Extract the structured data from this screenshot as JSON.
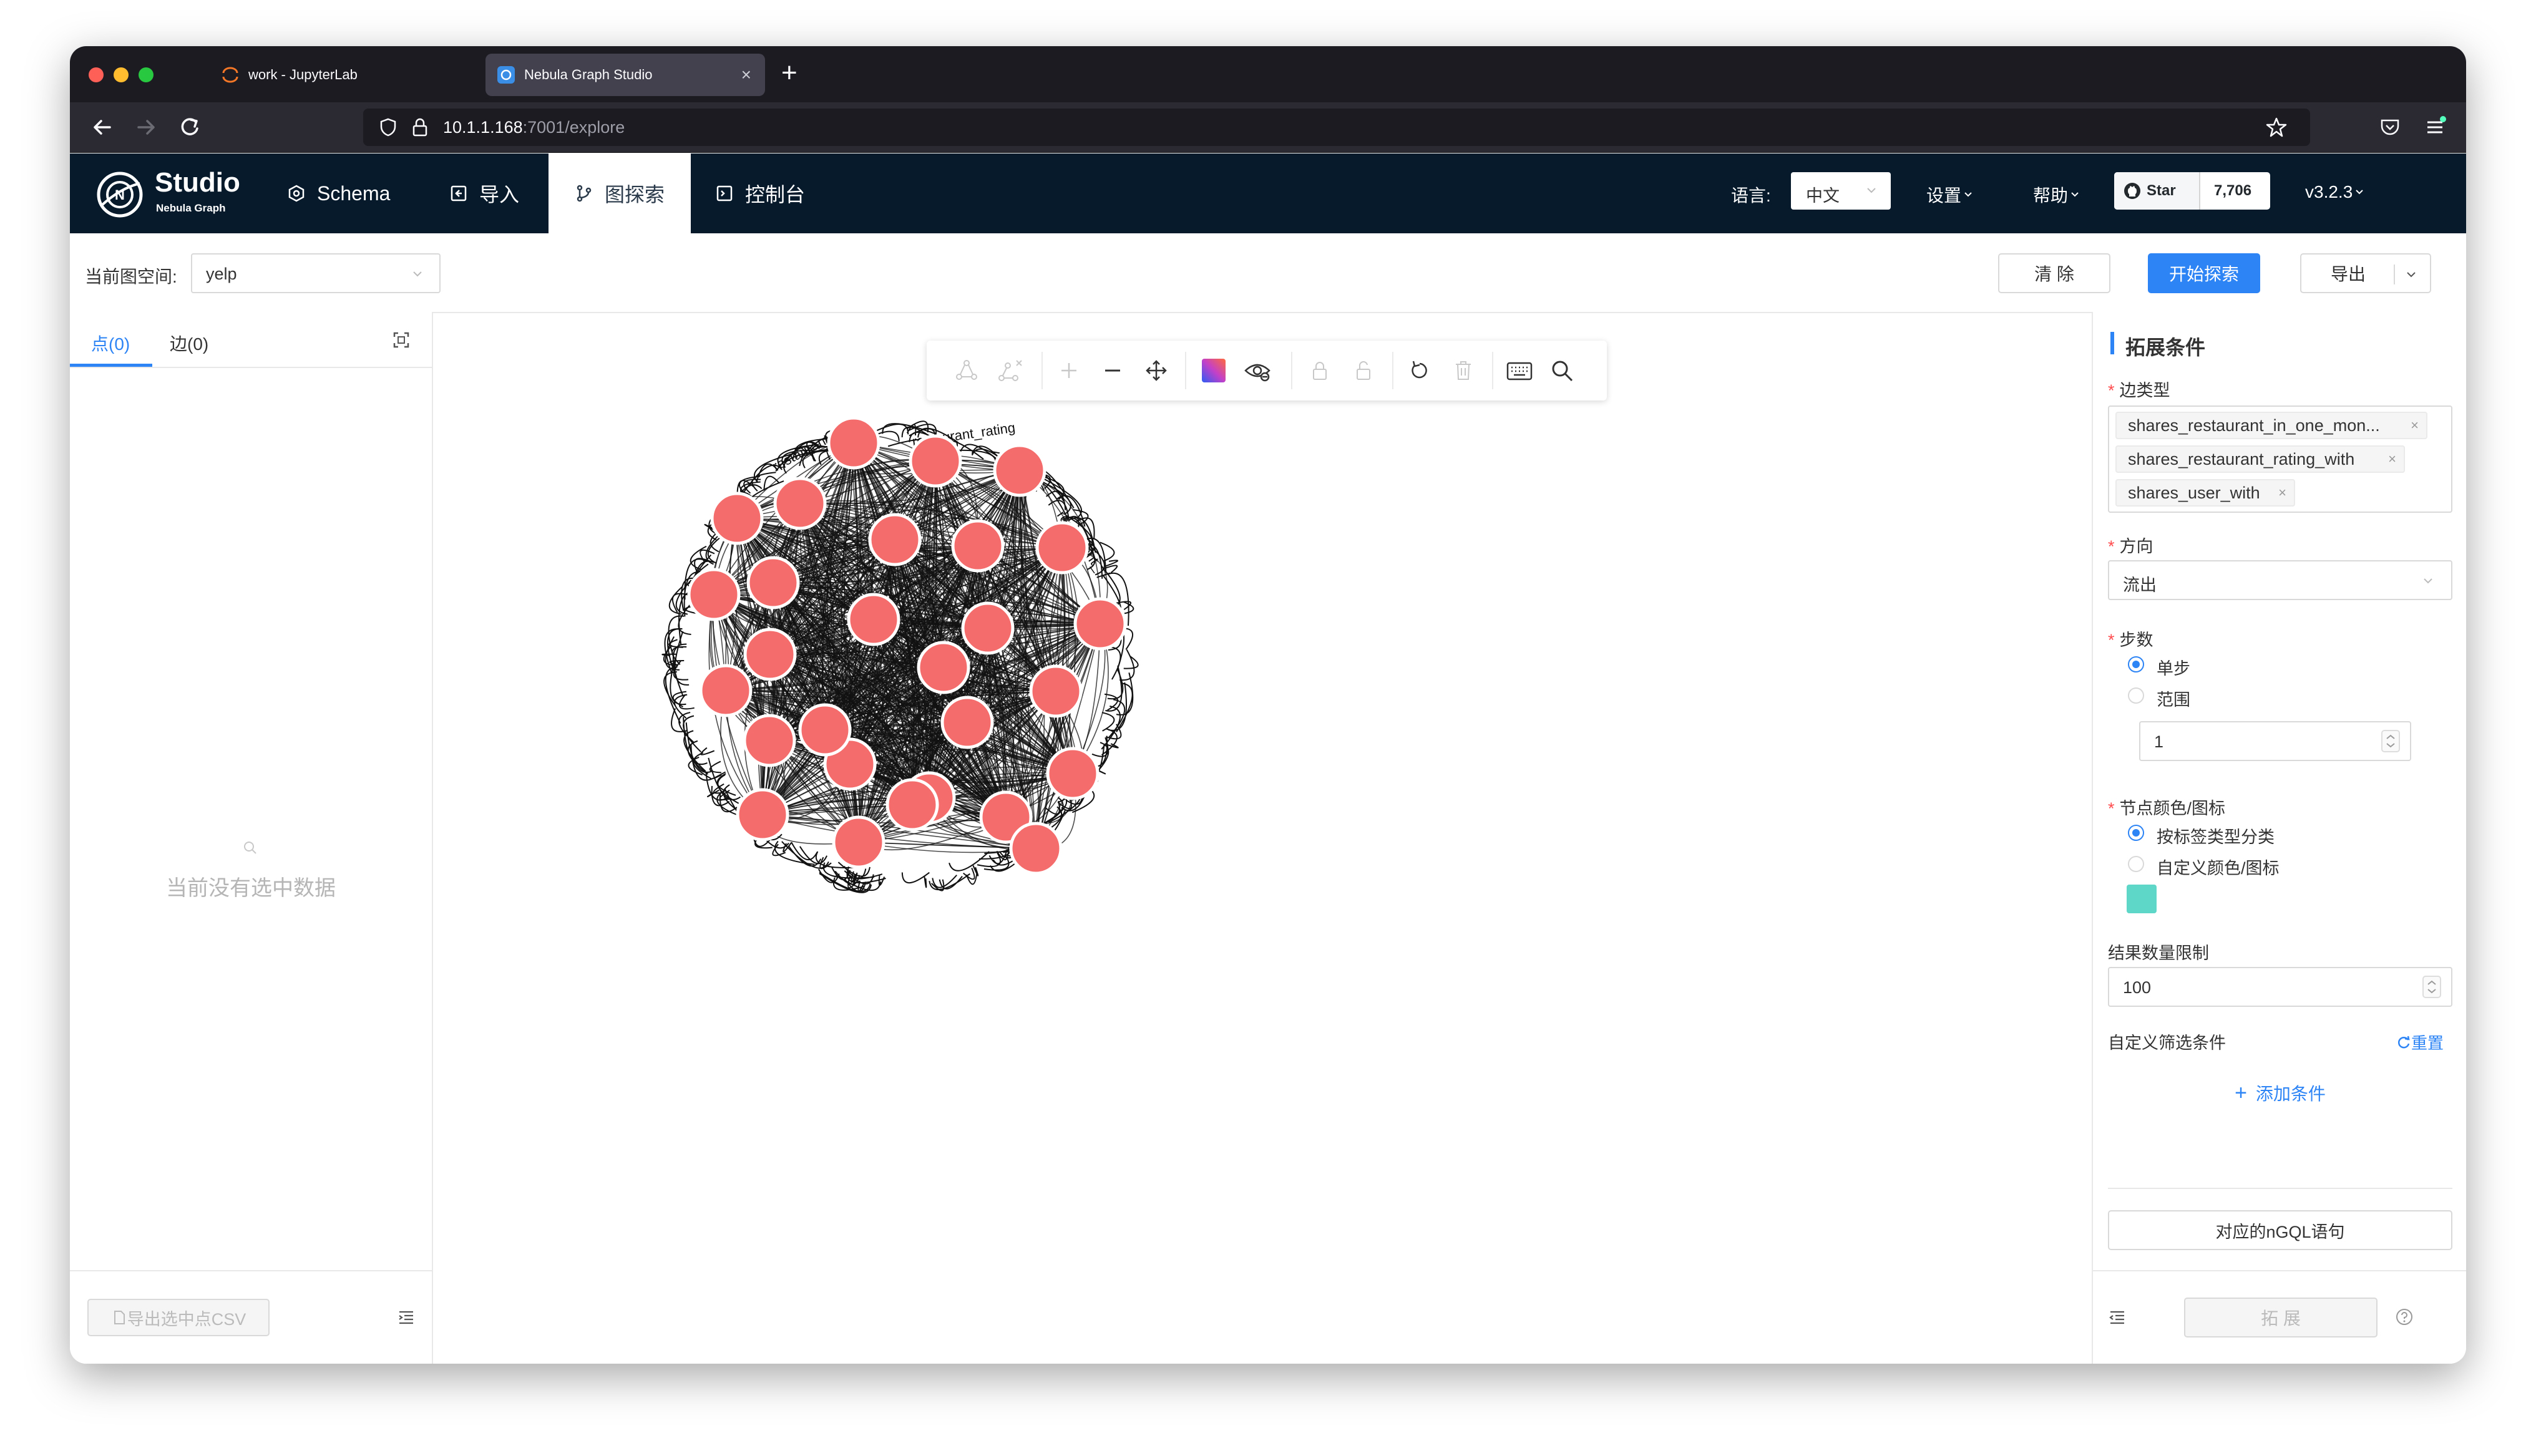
{
  "browser": {
    "tabs": [
      {
        "title": "work - JupyterLab",
        "icon": "jupyter-icon",
        "active": false
      },
      {
        "title": "Nebula Graph Studio",
        "icon": "nebula-icon",
        "active": true
      }
    ],
    "url_host": "10.1.1.168",
    "url_path": ":7001/explore"
  },
  "app": {
    "logo_title": "Studio",
    "logo_subtitle": "Nebula Graph",
    "nav": [
      {
        "label": "Schema",
        "icon": "schema-icon"
      },
      {
        "label": "导入",
        "icon": "import-icon"
      },
      {
        "label": "图探索",
        "icon": "explore-icon",
        "active": true
      },
      {
        "label": "控制台",
        "icon": "console-icon"
      }
    ],
    "language_label": "语言:",
    "language_value": "中文",
    "settings_label": "设置",
    "help_label": "帮助",
    "star_label": "Star",
    "star_count": "7,706",
    "version": "v3.2.3"
  },
  "subheader": {
    "space_label": "当前图空间:",
    "space_value": "yelp",
    "clear_button": "清 除",
    "start_button": "开始探索",
    "export_button": "导出"
  },
  "left_panel": {
    "tab_vertices": "点(0)",
    "tab_edges": "边(0)",
    "empty_text": "当前没有选中数据",
    "export_csv_button": "导出选中点CSV"
  },
  "graph": {
    "edge_label_fragments": [
      "restaurant_rating",
      "restaurant_rati",
      "restaurant_"
    ],
    "node_count": 28,
    "node_color": "#f56c6c"
  },
  "right_panel": {
    "title": "拓展条件",
    "edge_type_label": "边类型",
    "edge_types": [
      "shares_restaurant_in_one_mon...",
      "shares_restaurant_rating_with",
      "shares_user_with"
    ],
    "direction_label": "方向",
    "direction_value": "流出",
    "steps_label": "步数",
    "step_single": "单步",
    "step_range": "范围",
    "step_value": "1",
    "color_label": "节点颜色/图标",
    "color_by_tag": "按标签类型分类",
    "color_custom": "自定义颜色/图标",
    "swatch_color": "#5ed6c8",
    "limit_label": "结果数量限制",
    "limit_value": "100",
    "filter_label": "自定义筛选条件",
    "reset_label": "重置",
    "add_condition": "添加条件",
    "ngql_button": "对应的nGQL语句",
    "expand_button": "拓 展"
  },
  "colors": {
    "primary": "#2d84f5",
    "header_bg": "#061a2b",
    "node": "#f56c6c"
  }
}
